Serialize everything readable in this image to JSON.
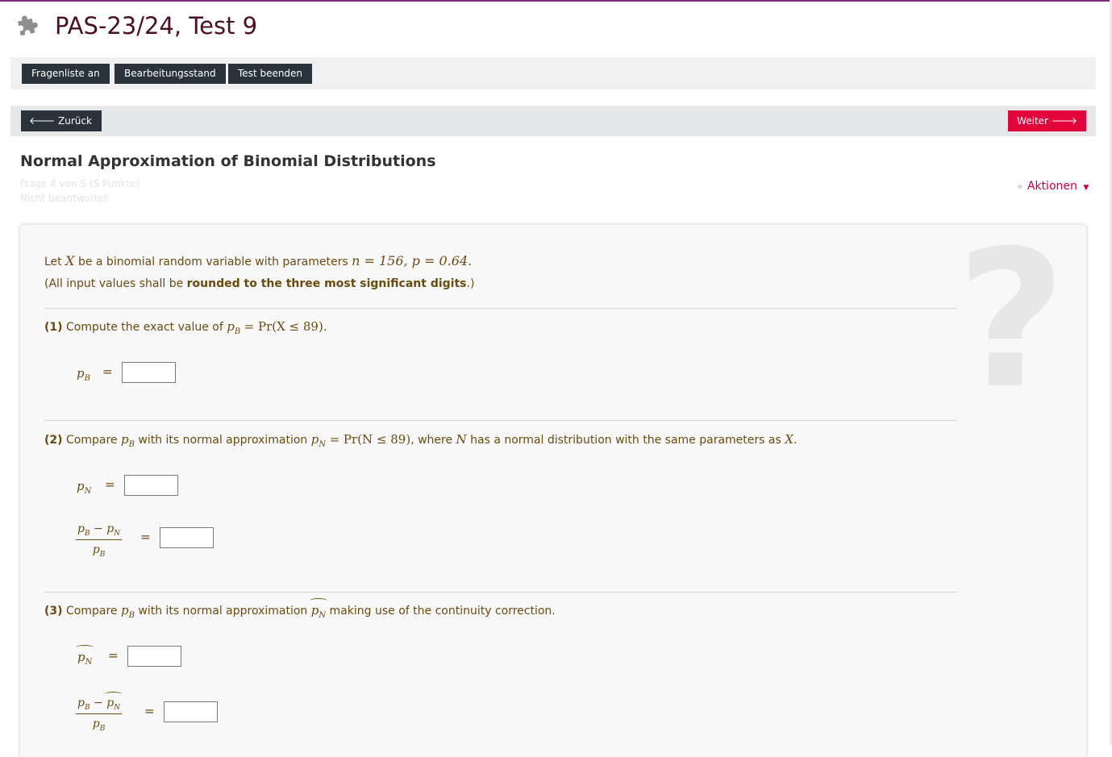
{
  "page_title": "PAS-23/24, Test 9",
  "nav_buttons": {
    "question_list": "Fragenliste an",
    "progress": "Bearbeitungsstand",
    "finish_test": "Test beenden",
    "back": "Zurück",
    "next": "Weiter"
  },
  "question": {
    "title": "Normal Approximation of Binomial Distributions",
    "info_line1": "Frage 4 von 5 (5 Punkte)",
    "info_line2": "Nicht beantwortet",
    "actions_label": "Aktionen"
  },
  "body": {
    "intro_pre": "Let ",
    "intro_var": "X",
    "intro_mid": " be a binomial random variable with parameters ",
    "intro_params": "n = 156, p = 0.64.",
    "rounding_pre": "(All input values shall be ",
    "rounding_bold": "rounded to the three most significant digits",
    "rounding_post": ".)",
    "part1_num": "(1)",
    "part1_text": " Compute the exact value of ",
    "part1_expr": "= Pr(X ≤ 89).",
    "part2_num": "(2)",
    "part2_text_a": " Compare ",
    "part2_text_b": " with its normal approximation ",
    "part2_expr": "= Pr(N ≤ 89)",
    "part2_text_c": ", where ",
    "part2_var_n": "N",
    "part2_text_d": " has a normal distribution with the same parameters as ",
    "part2_var_x": "X",
    "part2_end": ".",
    "part3_num": "(3)",
    "part3_text_a": " Compare ",
    "part3_text_b": " with its normal approximation ",
    "part3_text_c": " making use of the continuity correction.",
    "equals": "=",
    "minus": "−",
    "p": "p",
    "sub_b": "B",
    "sub_n": "N"
  },
  "inputs": {
    "pB_value": "",
    "pN_value": "",
    "rel_err_value": "",
    "pN_tilde_value": "",
    "rel_err_tilde_value": ""
  },
  "colors": {
    "accent_purple": "#7a2d7d",
    "title_color": "#4b0f26",
    "next_button": "#e2033b",
    "dark_button": "#2a333b",
    "content_text": "#6b4a10"
  }
}
